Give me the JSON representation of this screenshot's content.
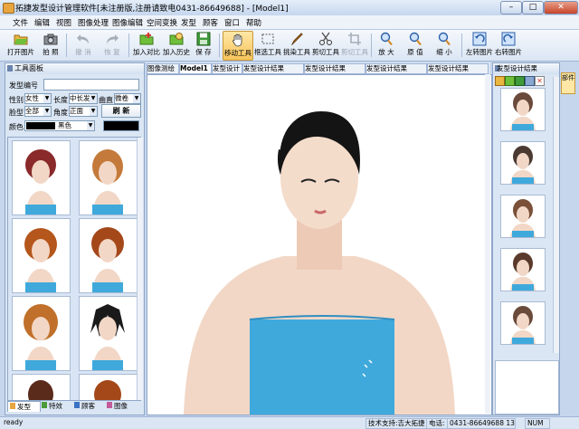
{
  "window": {
    "title": "拓捷发型设计管理软件[未注册版,注册请致电0431-86649688] - [Model1]",
    "min_label": "–",
    "max_label": "□",
    "close_label": "✕"
  },
  "menu": [
    "文件",
    "编辑",
    "视图",
    "图像处理",
    "图像编辑",
    "空间变换",
    "发型",
    "顾客",
    "窗口",
    "帮助"
  ],
  "toolbar": [
    {
      "label": "打开图片",
      "icon": "folder-open-icon",
      "state": "normal"
    },
    {
      "label": "拍 照",
      "icon": "camera-icon",
      "state": "normal"
    },
    {
      "label": "撤 消",
      "icon": "undo-icon",
      "state": "disabled"
    },
    {
      "label": "恢 复",
      "icon": "redo-icon",
      "state": "disabled"
    },
    {
      "label": "加入对比",
      "icon": "compare-add-icon",
      "state": "normal"
    },
    {
      "label": "加入历史",
      "icon": "history-add-icon",
      "state": "normal"
    },
    {
      "label": "保 存",
      "icon": "save-icon",
      "state": "normal"
    },
    {
      "label": "移动工具",
      "icon": "hand-icon",
      "state": "selected"
    },
    {
      "label": "框选工具",
      "icon": "marquee-icon",
      "state": "normal"
    },
    {
      "label": "挑染工具",
      "icon": "brush-icon",
      "state": "normal"
    },
    {
      "label": "剪切工具",
      "icon": "scissors-icon",
      "state": "normal"
    },
    {
      "label": "剪切工具",
      "icon": "crop-icon",
      "state": "disabled"
    },
    {
      "label": "放 大",
      "icon": "zoom-in-icon",
      "state": "normal"
    },
    {
      "label": "原 值",
      "icon": "zoom-reset-icon",
      "state": "normal"
    },
    {
      "label": "缩 小",
      "icon": "zoom-out-icon",
      "state": "normal"
    },
    {
      "label": "左转图片",
      "icon": "rotate-left-icon",
      "state": "normal"
    },
    {
      "label": "右转图片",
      "icon": "rotate-right-icon",
      "state": "normal"
    }
  ],
  "left_panel": {
    "title": "工具面板",
    "hair_no_label": "发型编号",
    "hair_no_value": "",
    "gender_label": "性别",
    "gender_value": "女性",
    "length_label": "长度",
    "length_value": "中长发",
    "curl_label": "曲直",
    "curl_value": "微卷",
    "face_label": "脸型",
    "face_value": "全部",
    "angle_label": "角度",
    "angle_value": "正面",
    "refresh_label": "刷 新",
    "color_label": "颜色",
    "color_value": "黑色",
    "color_name": "黑色"
  },
  "bottom_tabs": [
    "发型",
    "特效",
    "顾客",
    "图像"
  ],
  "doc_tabs": [
    {
      "label": "图像测绘",
      "active": false
    },
    {
      "label": "Model1",
      "active": true
    },
    {
      "label": "发型设计",
      "active": false
    },
    {
      "label": "发型设计结果",
      "active": false
    },
    {
      "label": "发型设计结果",
      "active": false
    },
    {
      "label": "发型设计结果",
      "active": false
    },
    {
      "label": "发型设计结果",
      "active": false
    }
  ],
  "right_panel": {
    "title": "发型设计结果"
  },
  "side_tab": "部件",
  "status": {
    "ready": "ready",
    "tech_support": "技术支持:吉大拓捷",
    "phone_label": "电话:",
    "phone_value": "0431-86649688 13",
    "num": "NUM"
  },
  "colors": {
    "accent": "#f7c45b",
    "panel": "#dbe6f4",
    "skin": "#f2d7c6",
    "top": "#3fa9dc"
  }
}
